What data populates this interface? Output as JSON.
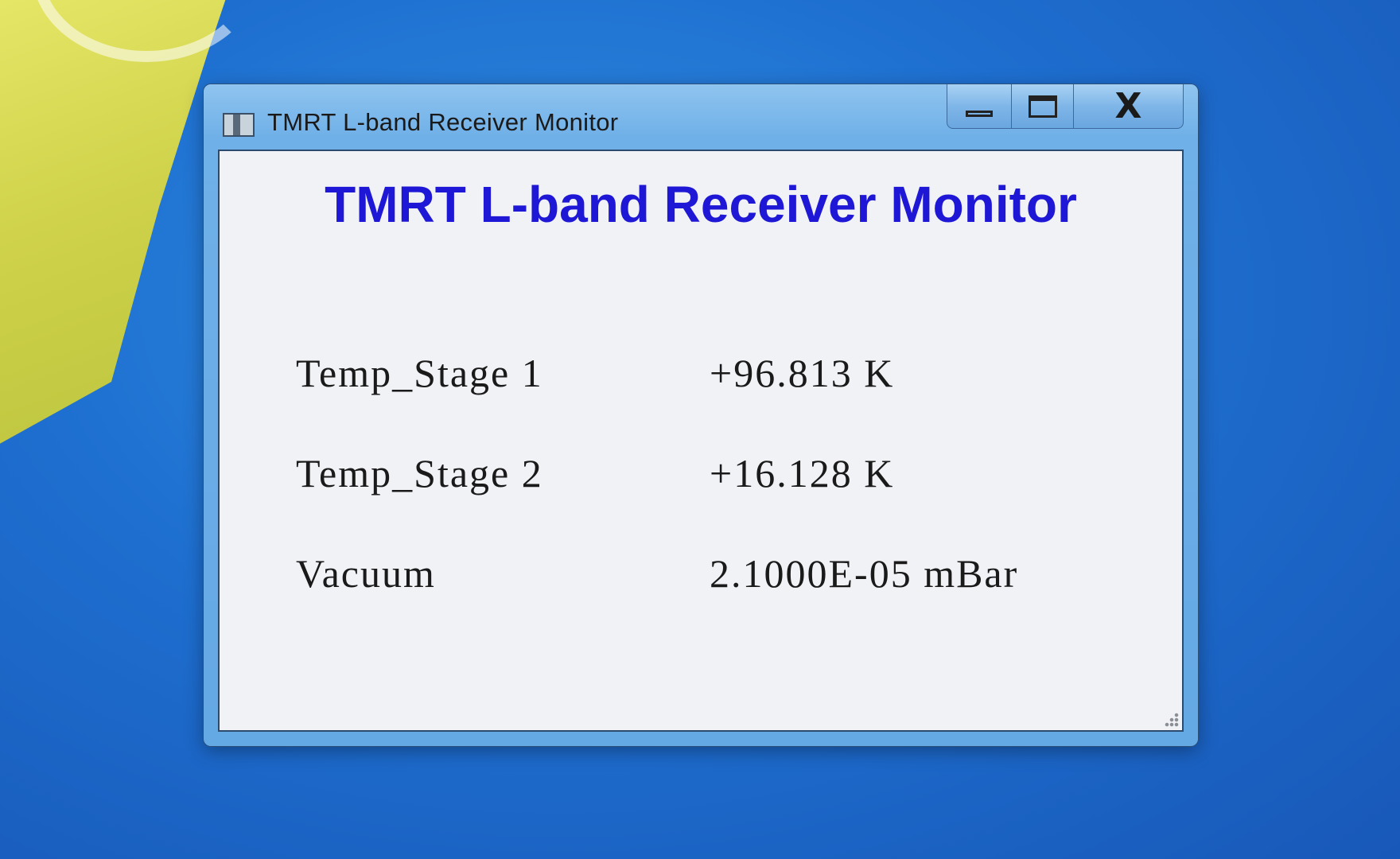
{
  "window": {
    "title": "TMRT L-band Receiver Monitor",
    "caption_buttons": {
      "minimize_icon": "minimize-icon",
      "maximize_icon": "maximize-icon",
      "close_label": "X"
    }
  },
  "monitor": {
    "heading": "TMRT L-band Receiver Monitor",
    "heading_color": "#1e17d6",
    "readings": [
      {
        "label": "Temp_Stage 1",
        "value": "+96.813 K"
      },
      {
        "label": "Temp_Stage 2",
        "value": "+16.128 K"
      },
      {
        "label": "Vacuum",
        "value": "2.1000E-05 mBar"
      }
    ]
  },
  "desktop": {
    "background_color": "#1e6fd0",
    "accent_color": "#d4d64c"
  }
}
